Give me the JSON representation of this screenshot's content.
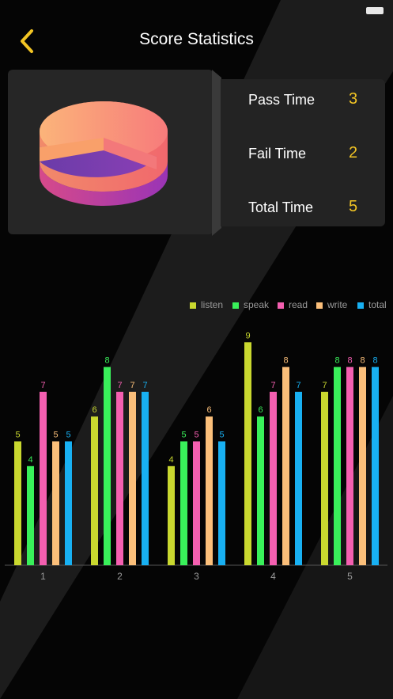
{
  "header": {
    "title": "Score Statistics",
    "back_icon": "chevron-left-icon",
    "accent": "#f3c524"
  },
  "summary": {
    "pie_icon": "3d-pie-chart",
    "stats": [
      {
        "label": "Pass Time",
        "value": "3"
      },
      {
        "label": "Fail Time",
        "value": "2"
      },
      {
        "label": "Total Time",
        "value": "5"
      }
    ]
  },
  "chart_data": {
    "type": "bar",
    "categories": [
      "1",
      "2",
      "3",
      "4",
      "5"
    ],
    "series": [
      {
        "name": "listen",
        "color": "#c9d82f",
        "values": [
          5,
          6,
          4,
          9,
          7
        ]
      },
      {
        "name": "speak",
        "color": "#39f05a",
        "values": [
          4,
          8,
          5,
          6,
          8
        ]
      },
      {
        "name": "read",
        "color": "#f45fb0",
        "values": [
          7,
          7,
          5,
          7,
          8
        ]
      },
      {
        "name": "write",
        "color": "#fbbf7a",
        "values": [
          5,
          7,
          6,
          8,
          8
        ]
      },
      {
        "name": "total",
        "color": "#18b0f2",
        "values": [
          5,
          7,
          5,
          7,
          8
        ]
      }
    ],
    "ylim": [
      0,
      10
    ],
    "legend": "top-right",
    "grid": false
  }
}
